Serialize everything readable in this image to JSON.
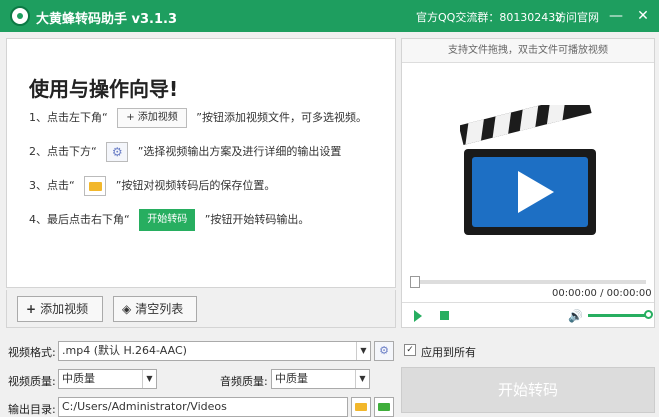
{
  "titlebar": {
    "title": "大黄蜂转码助手 v3.1.3",
    "qq_group": "官方QQ交流群：801302432",
    "site_link": "访问官网",
    "minimize": "—",
    "close": "✕"
  },
  "guide": {
    "title": "使用与操作向导!",
    "step1": {
      "prefix": "1、点击左下角“",
      "button": "+ 添加视频",
      "suffix": "”按钮添加视频文件，可多选视频。"
    },
    "step2": {
      "prefix": "2、点击下方“",
      "suffix": "”选择视频输出方案及进行详细的输出设置"
    },
    "step3": {
      "prefix": "3、点击“",
      "suffix": "”按钮对视频转码后的保存位置。"
    },
    "step4": {
      "prefix": "4、最后点击右下角“",
      "button": "开始转码",
      "suffix": "”按钮开始转码输出。"
    }
  },
  "toolbar": {
    "add_icon": "+",
    "add_label": "添加视频",
    "clear_icon": "◈",
    "clear_label": "清空列表"
  },
  "preview": {
    "hint": "支持文件拖拽，双击文件可播放视频",
    "time": "00:00:00  /  00:00:00",
    "progress": 0,
    "volume_icon": "🔊"
  },
  "settings": {
    "format_label": "视频格式:",
    "format_value": ".mp4 (默认 H.264-AAC)",
    "apply_all_label": "应用到所有",
    "apply_all_checked": "✓",
    "video_quality_label": "视频质量:",
    "video_quality_value": "中质量",
    "audio_quality_label": "音频质量:",
    "audio_quality_value": "中质量",
    "output_label": "输出目录:",
    "output_path": "C:/Users/Administrator/Videos",
    "start_button": "开始转码"
  },
  "colors": {
    "accent": "#1e9e5f",
    "start_disabled": "#dcdcdc",
    "folder": "#f2b72b"
  }
}
